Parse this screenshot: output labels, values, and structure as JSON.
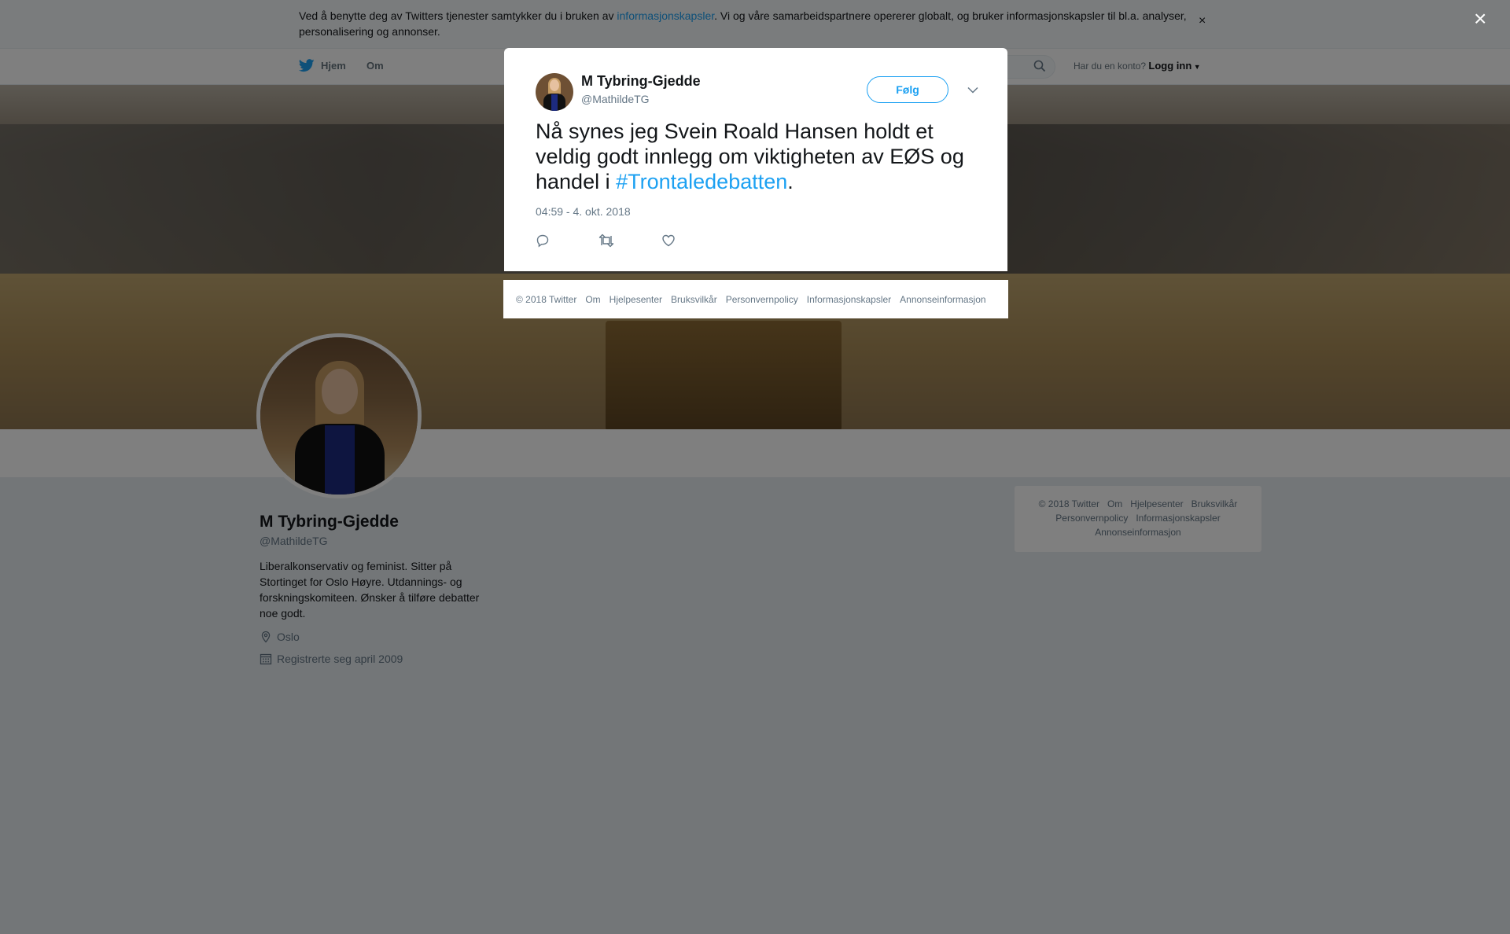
{
  "cookie_banner": {
    "text_before": "Ved å benytte deg av Twitters tjenester samtykker du i bruken av ",
    "link": "informasjonskapsler",
    "text_after": ". Vi og våre samarbeidspartnere opererer globalt, og bruker informasjonskapsler til bl.a. analyser, personalisering og annonser.",
    "close": "×"
  },
  "nav": {
    "home": "Hjem",
    "about": "Om",
    "login_prompt": "Har du en konto?",
    "login": "Logg inn"
  },
  "profile": {
    "name": "M Tybring-Gjedde",
    "handle": "@MathildeTG",
    "bio": "Liberalkonservativ og feminist. Sitter på Stortinget for Oslo Høyre. Utdannings- og forskningskomiteen. Ønsker å tilføre debatter noe godt.",
    "location": "Oslo",
    "joined": "Registrerte seg april 2009"
  },
  "side_footer": {
    "items": [
      "© 2018 Twitter",
      "Om",
      "Hjelpesenter",
      "Bruksvilkår",
      "Personvernpolicy",
      "Informasjonskapsler",
      "Annonseinformasjon"
    ]
  },
  "overlay": {
    "close": "×"
  },
  "tweet": {
    "name": "M Tybring-Gjedde",
    "handle": "@MathildeTG",
    "follow": "Følg",
    "text_before": "Nå synes jeg Svein Roald Hansen holdt et veldig godt innlegg om viktigheten av EØS og handel i ",
    "hashtag": "#Trontaledebatten",
    "text_after": ".",
    "timestamp": "04:59 - 4. okt. 2018"
  },
  "modal_footer": {
    "items": [
      "© 2018 Twitter",
      "Om",
      "Hjelpesenter",
      "Bruksvilkår",
      "Personvernpolicy",
      "Informasjonskapsler",
      "Annonseinformasjon"
    ]
  },
  "colors": {
    "accent": "#1da1f2",
    "text": "#14171a",
    "muted": "#657786"
  }
}
